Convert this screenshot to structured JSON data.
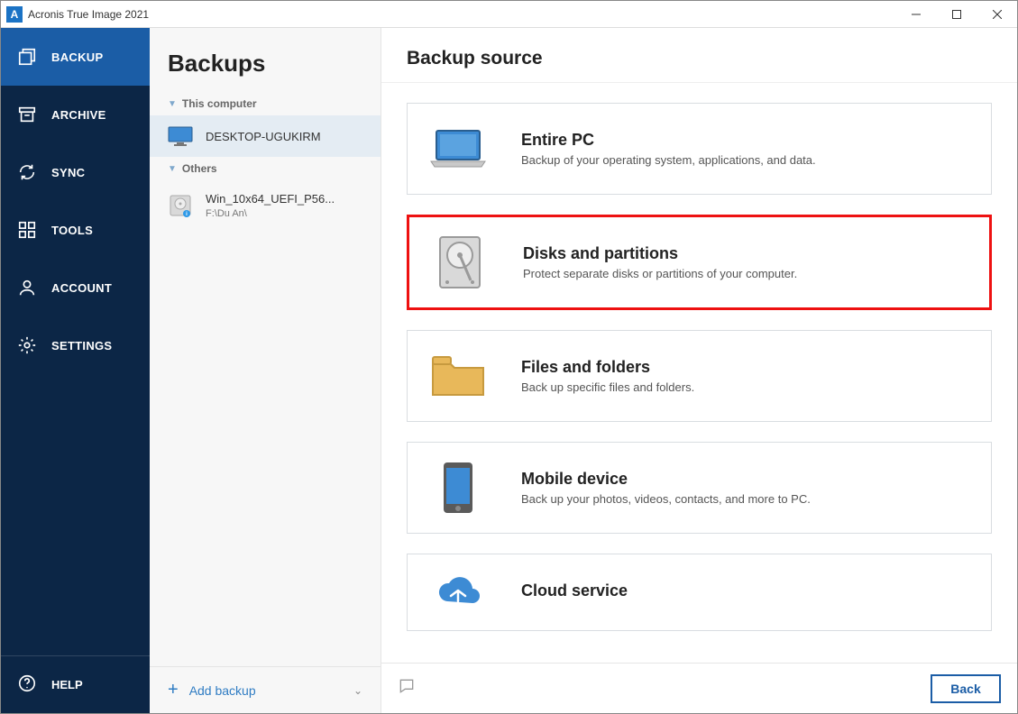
{
  "app": {
    "title": "Acronis True Image 2021",
    "icon_letter": "A"
  },
  "nav": {
    "items": [
      {
        "label": "BACKUP"
      },
      {
        "label": "ARCHIVE"
      },
      {
        "label": "SYNC"
      },
      {
        "label": "TOOLS"
      },
      {
        "label": "ACCOUNT"
      },
      {
        "label": "SETTINGS"
      }
    ],
    "help": "HELP"
  },
  "list": {
    "heading": "Backups",
    "group1": "This computer",
    "item1": "DESKTOP-UGUKIRM",
    "group2": "Others",
    "item2_title": "Win_10x64_UEFI_P56...",
    "item2_sub": "F:\\Du An\\",
    "add_label": "Add backup"
  },
  "main": {
    "heading": "Backup source",
    "cards": [
      {
        "title": "Entire PC",
        "desc": "Backup of your operating system, applications, and data."
      },
      {
        "title": "Disks and partitions",
        "desc": "Protect separate disks or partitions of your computer."
      },
      {
        "title": "Files and folders",
        "desc": "Back up specific files and folders."
      },
      {
        "title": "Mobile device",
        "desc": "Back up your photos, videos, contacts, and more to PC."
      },
      {
        "title": "Cloud service",
        "desc": ""
      }
    ],
    "back": "Back"
  }
}
